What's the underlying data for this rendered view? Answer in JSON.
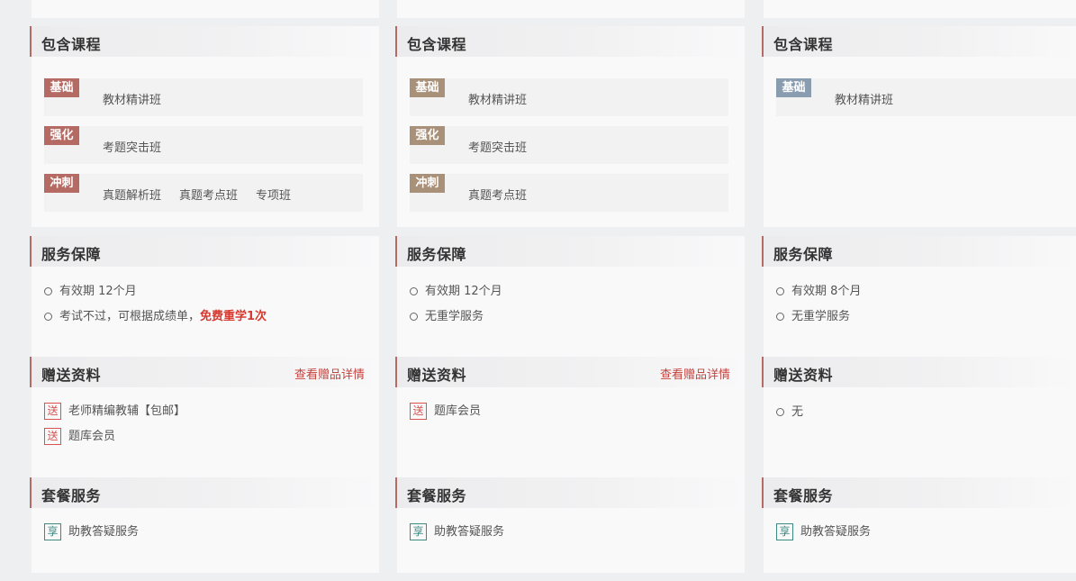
{
  "columns": [
    {
      "courses_title": "包含课程",
      "courses": [
        {
          "badge": "基础",
          "names": [
            "教材精讲班"
          ]
        },
        {
          "badge": "强化",
          "names": [
            "考题突击班"
          ]
        },
        {
          "badge": "冲刺",
          "names": [
            "真题解析班",
            "真题考点班",
            "专项班"
          ]
        }
      ],
      "service_title": "服务保障",
      "service_items": [
        {
          "text": "有效期 12个月",
          "highlight": ""
        },
        {
          "text": "考试不过，可根据成绩单，",
          "highlight": "免费重学1次"
        }
      ],
      "gift_title": "赠送资料",
      "gift_link": "查看赠品详情",
      "gift_tag": "送",
      "gift_items": [
        "老师精编教辅【包邮】",
        "题库会员"
      ],
      "package_title": "套餐服务",
      "package_tag": "享",
      "package_items": [
        "助教答疑服务"
      ]
    },
    {
      "courses_title": "包含课程",
      "courses": [
        {
          "badge": "基础",
          "names": [
            "教材精讲班"
          ]
        },
        {
          "badge": "强化",
          "names": [
            "考题突击班"
          ]
        },
        {
          "badge": "冲刺",
          "names": [
            "真题考点班"
          ]
        }
      ],
      "service_title": "服务保障",
      "service_items": [
        {
          "text": "有效期 12个月",
          "highlight": ""
        },
        {
          "text": "无重学服务",
          "highlight": ""
        }
      ],
      "gift_title": "赠送资料",
      "gift_link": "查看赠品详情",
      "gift_tag": "送",
      "gift_items": [
        "题库会员"
      ],
      "package_title": "套餐服务",
      "package_tag": "享",
      "package_items": [
        "助教答疑服务"
      ]
    },
    {
      "courses_title": "包含课程",
      "courses": [
        {
          "badge": "基础",
          "names": [
            "教材精讲班"
          ]
        }
      ],
      "service_title": "服务保障",
      "service_items": [
        {
          "text": "有效期 8个月",
          "highlight": ""
        },
        {
          "text": "无重学服务",
          "highlight": ""
        }
      ],
      "gift_title": "赠送资料",
      "gift_none": "无",
      "package_title": "套餐服务",
      "package_tag": "享",
      "package_items": [
        "助教答疑服务"
      ]
    }
  ],
  "colors": {
    "accent": "#b56b63",
    "badge_column1": "#b56b63",
    "badge_column2": "#a99079",
    "badge_column3": "#8a9cb0",
    "highlight_red": "#d43a30",
    "tag_green": "#3d8a80"
  }
}
